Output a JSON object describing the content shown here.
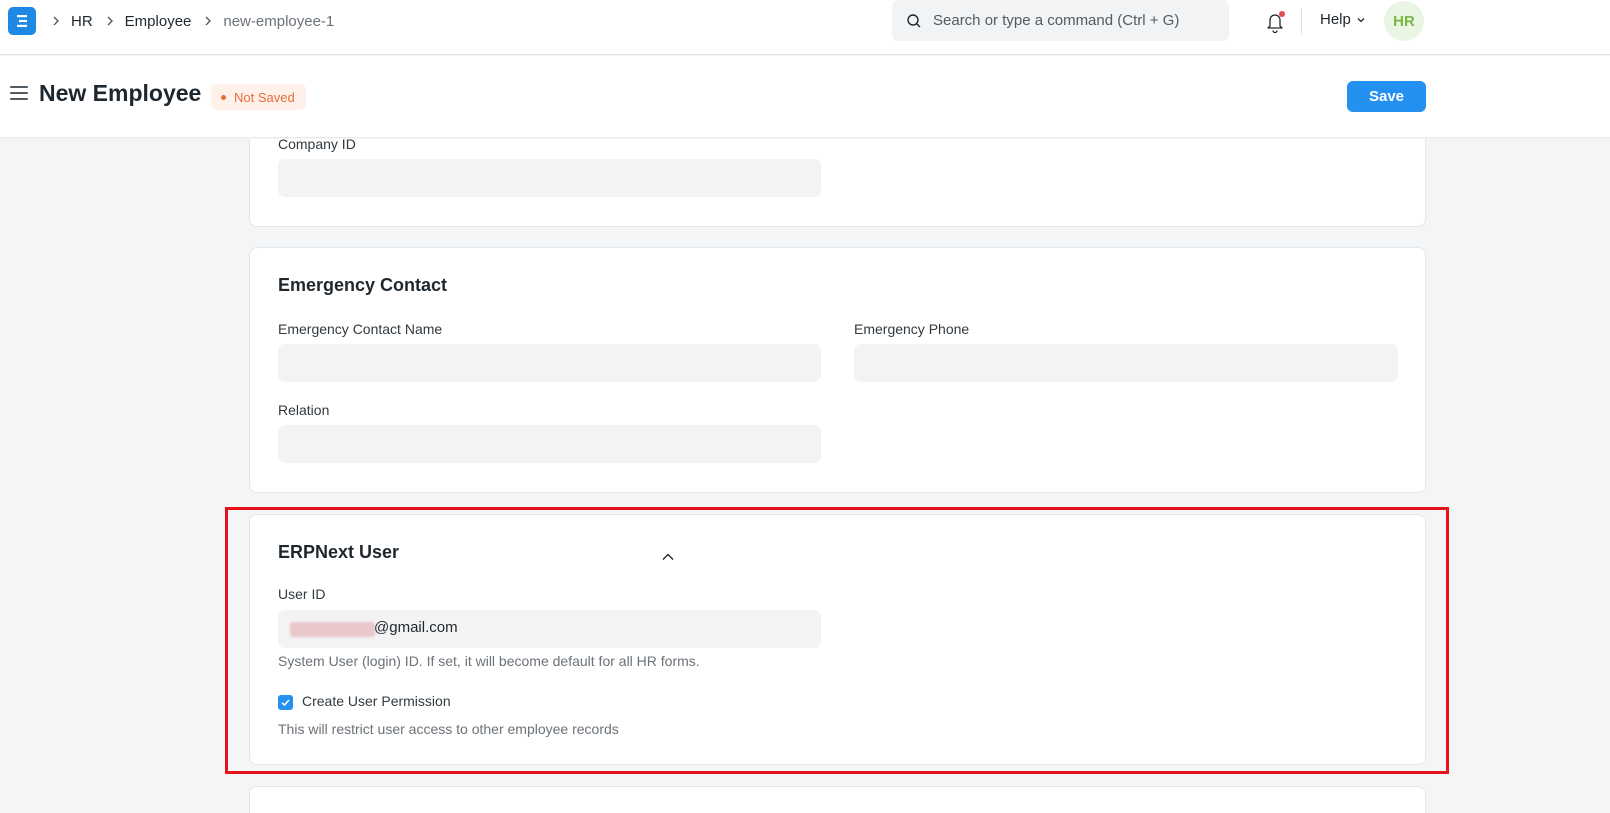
{
  "navbar": {
    "breadcrumbs": [
      "HR",
      "Employee",
      "new-employee-1"
    ],
    "search_placeholder": "Search or type a command (Ctrl + G)",
    "help_label": "Help",
    "avatar_initials": "HR"
  },
  "page": {
    "title": "New Employee",
    "status": "Not Saved",
    "save_label": "Save"
  },
  "sections": {
    "company": {
      "company_id_label": "Company ID",
      "company_id_value": ""
    },
    "emergency": {
      "title": "Emergency Contact",
      "contact_name_label": "Emergency Contact Name",
      "contact_name_value": "",
      "phone_label": "Emergency Phone",
      "phone_value": "",
      "relation_label": "Relation",
      "relation_value": ""
    },
    "erpnext_user": {
      "title": "ERPNext User",
      "user_id_label": "User ID",
      "user_id_value": "@gmail.com",
      "user_id_help": "System User (login) ID. If set, it will become default for all HR forms.",
      "create_permission_label": "Create User Permission",
      "create_permission_checked": true,
      "create_permission_help": "This will restrict user access to other employee records"
    }
  },
  "colors": {
    "primary": "#2490ef",
    "status_text": "#e86c3a",
    "status_bg": "#fff1ea",
    "highlight": "#e8121b",
    "avatar_text": "#7ab845"
  }
}
